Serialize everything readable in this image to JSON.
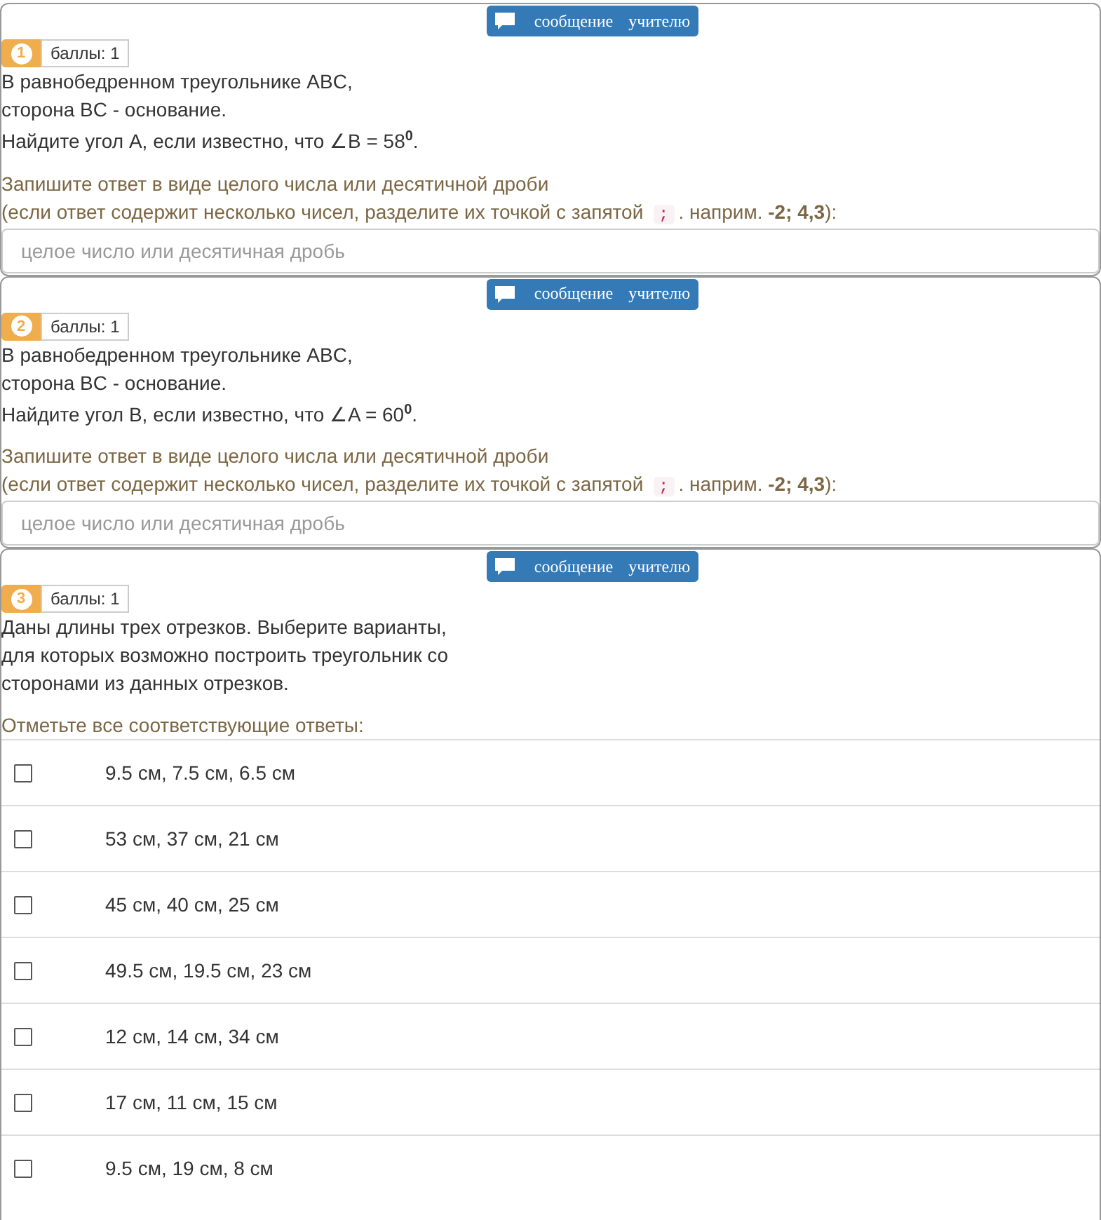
{
  "questions": [
    {
      "number": "1",
      "points": "баллы: 1",
      "message_button": "сообщение учителю",
      "kind": "text",
      "text_lines": [
        "В равнобедренном треугольнике ABC,",
        "сторона BC - основание.",
        "Найдите угол A, если известно, что ∠B = 58$^{0}$."
      ],
      "hint_line": "Запишите ответ в виде целого числа или десятичной дроби",
      "hint_before": "(если ответ содержит несколько чисел, разделите их точкой с запятой",
      "hint_code": ";",
      "hint_after": ". наприм. **-2; 4,3**):",
      "placeholder": "целое число или десятичная дробь"
    },
    {
      "number": "2",
      "points": "баллы: 1",
      "message_button": "сообщение учителю",
      "kind": "text",
      "text_lines": [
        "В равнобедренном треугольнике ABC,",
        "сторона BC - основание.",
        "Найдите угол B, если известно, что ∠A = 60$^{0}$."
      ],
      "hint_line": "Запишите ответ в виде целого числа или десятичной дроби",
      "hint_before": "(если ответ содержит несколько чисел, разделите их точкой с запятой",
      "hint_code": ";",
      "hint_after": ". наприм. **-2; 4,3**):",
      "placeholder": "целое число или десятичная дробь"
    },
    {
      "number": "3",
      "points": "баллы: 1",
      "message_button": "сообщение учителю",
      "kind": "choice",
      "text_lines": [
        "Даны длины трех отрезков. Выберите варианты,",
        "для которых возможно построить треугольник со",
        "сторонами из данных отрезков."
      ],
      "hint_line": "Отметьте все соответствующие ответы:",
      "options": [
        {
          "label": "9.5 см, 7.5 см, 6.5 см",
          "checked": false
        },
        {
          "label": "53 см, 37 см, 21 см",
          "checked": false
        },
        {
          "label": "45 см, 40 см, 25 см",
          "checked": false
        },
        {
          "label": "49.5 см, 19.5 см, 23 см",
          "checked": false
        },
        {
          "label": "12 см, 14 см, 34 см",
          "checked": false
        },
        {
          "label": "17 см, 11 см, 15 см",
          "checked": false
        },
        {
          "label": "9.5 см, 19 см, 8 см",
          "checked": false
        }
      ]
    }
  ]
}
